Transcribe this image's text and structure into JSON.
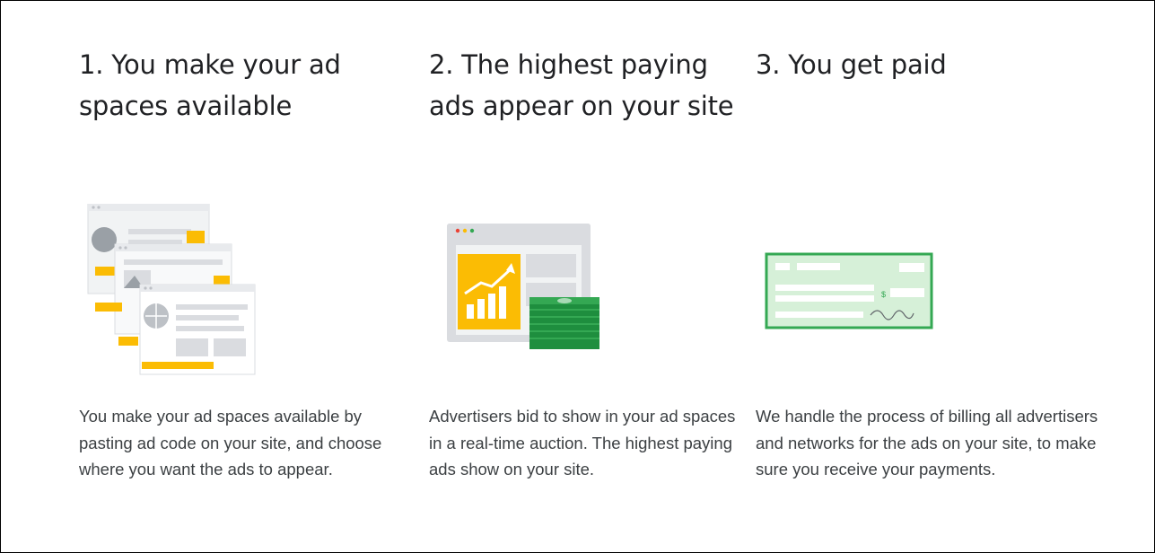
{
  "steps": [
    {
      "title": "1. You make your ad spaces available",
      "description": "You make your ad spaces available by pasting ad code on your site, and choose where you want the ads to appear.",
      "illustration_icon": "stacked-webpages-icon"
    },
    {
      "title": "2. The highest paying ads appear on your site",
      "description": "Advertisers bid to show in your ad spaces in a real-time auction. The highest paying ads show on your site.",
      "illustration_icon": "browser-chart-money-icon"
    },
    {
      "title": "3. You get paid",
      "description": "We handle the process of billing all advertisers and networks for the ads on your site, to make sure you receive your payments.",
      "illustration_icon": "check-payment-icon"
    }
  ],
  "colors": {
    "accent_yellow": "#fbbc04",
    "page_gray": "#e8eaed",
    "money_green": "#34a853",
    "check_bg": "#d6f0d8",
    "check_border": "#34a853"
  }
}
